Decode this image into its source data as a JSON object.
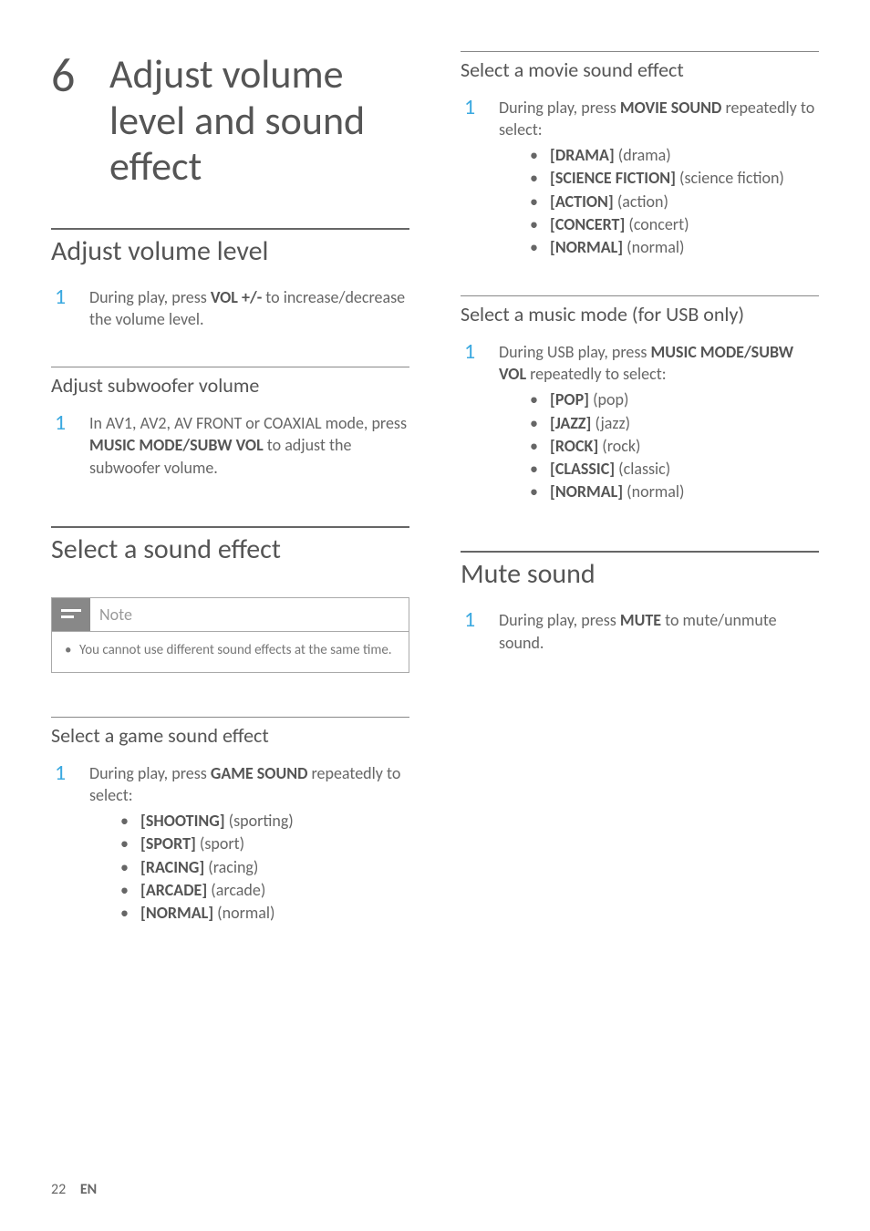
{
  "chapter": {
    "number": "6",
    "title": "Adjust volume level and sound effect"
  },
  "col1": {
    "h2_volume": "Adjust volume level",
    "step_volume": {
      "num": "1",
      "pre": "During play, press ",
      "bold": "VOL +/-",
      "post": " to increase/decrease the volume level."
    },
    "h3_subwoofer": "Adjust subwoofer volume",
    "step_subwoofer": {
      "num": "1",
      "pre": "In AV1, AV2, AV FRONT or COAXIAL mode, press ",
      "bold": "MUSIC MODE/SUBW VOL",
      "post": " to adjust the subwoofer volume."
    },
    "h2_sound_effect": "Select a sound effect",
    "note": {
      "title": "Note",
      "item": "You cannot use different sound effects at the same time."
    },
    "h3_game": "Select a game sound effect",
    "step_game": {
      "num": "1",
      "pre": "During play, press ",
      "bold": "GAME SOUND",
      "post": " repeatedly to select:"
    },
    "game_opts": [
      {
        "bold": "[SHOOTING]",
        "desc": " (sporting)"
      },
      {
        "bold": "[SPORT]",
        "desc": " (sport)"
      },
      {
        "bold": "[RACING]",
        "desc": " (racing)"
      },
      {
        "bold": "[ARCADE]",
        "desc": " (arcade)"
      },
      {
        "bold": "[NORMAL]",
        "desc": " (normal)"
      }
    ]
  },
  "col2": {
    "h3_movie": "Select a movie sound effect",
    "step_movie": {
      "num": "1",
      "pre": "During play, press ",
      "bold": "MOVIE SOUND",
      "post": " repeatedly to select:"
    },
    "movie_opts": [
      {
        "bold": "[DRAMA]",
        "desc": " (drama)"
      },
      {
        "bold": "[SCIENCE FICTION]",
        "desc": " (science fiction)"
      },
      {
        "bold": "[ACTION]",
        "desc": " (action)"
      },
      {
        "bold": "[CONCERT]",
        "desc": " (concert)"
      },
      {
        "bold": "[NORMAL]",
        "desc": " (normal)"
      }
    ],
    "h3_music": "Select a music mode (for USB only)",
    "step_music": {
      "num": "1",
      "pre": "During USB play, press ",
      "bold": "MUSIC MODE/SUBW VOL",
      "post": " repeatedly to select:"
    },
    "music_opts": [
      {
        "bold": "[POP]",
        "desc": " (pop)"
      },
      {
        "bold": "[JAZZ]",
        "desc": " (jazz)"
      },
      {
        "bold": "[ROCK]",
        "desc": " (rock)"
      },
      {
        "bold": "[CLASSIC]",
        "desc": " (classic)"
      },
      {
        "bold": "[NORMAL]",
        "desc": " (normal)"
      }
    ],
    "h2_mute": "Mute sound",
    "step_mute": {
      "num": "1",
      "pre": "During play, press ",
      "bold": "MUTE",
      "post": " to mute/unmute sound."
    }
  },
  "footer": {
    "page": "22",
    "lang": "EN"
  }
}
